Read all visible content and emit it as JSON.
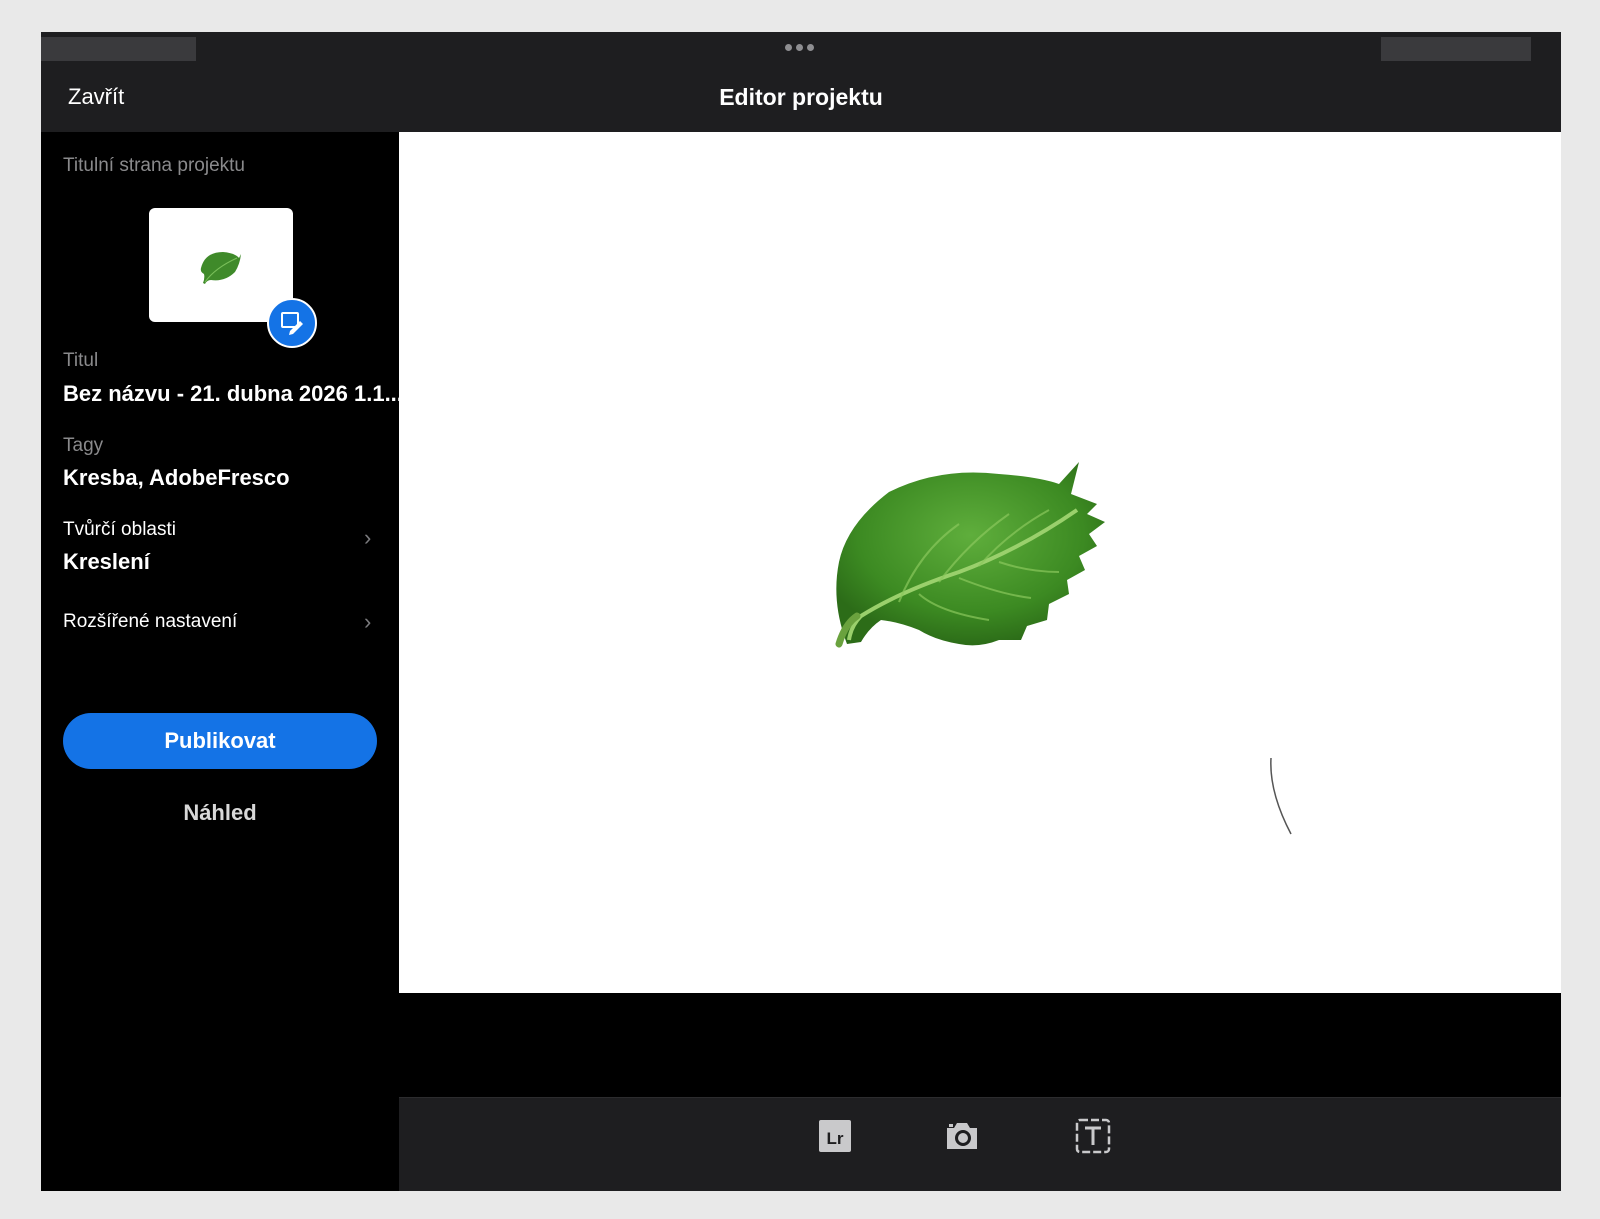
{
  "header": {
    "close_label": "Zavřít",
    "title": "Editor projektu"
  },
  "sidebar": {
    "cover_label": "Titulní strana projektu",
    "title_label": "Titul",
    "title_value": "Bez názvu - 21. dubna 2026 1.1...",
    "tags_label": "Tagy",
    "tags_value": "Kresba, AdobeFresco",
    "creative_fields_label": "Tvůrčí oblasti",
    "creative_fields_value": "Kreslení",
    "advanced_label": "Rozšířené nastavení",
    "publish_label": "Publikovat",
    "preview_label": "Náhled"
  },
  "toolbar": {
    "tools": [
      "lightroom-icon",
      "camera-icon",
      "text-icon"
    ]
  },
  "colors": {
    "accent": "#1473e6",
    "panel": "#1e1e20",
    "background": "#000000"
  }
}
